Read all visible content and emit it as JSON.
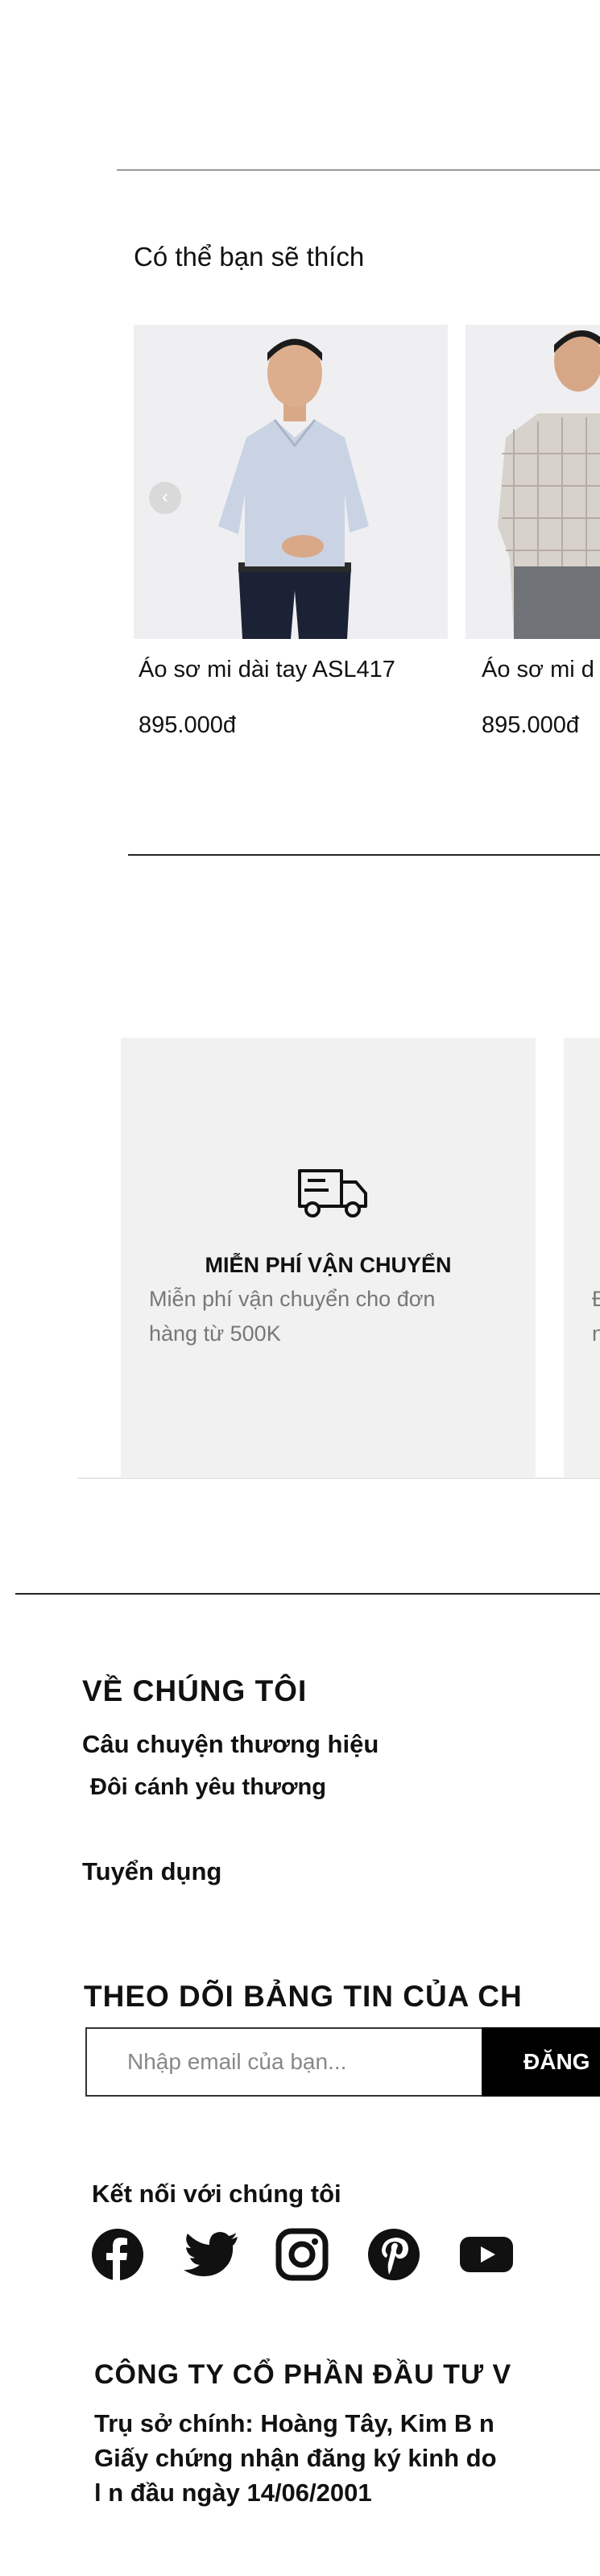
{
  "recommend": {
    "title": "Có thể bạn sẽ thích",
    "prev_arrow": "‹",
    "products": [
      {
        "name": "Áo sơ mi dài tay ASL417",
        "price": "895.000đ"
      },
      {
        "name": "Áo sơ mi d",
        "price": "895.000đ"
      }
    ]
  },
  "features": [
    {
      "icon": "truck-icon",
      "title": "MIỄN PHÍ VẬN CHUYỂN",
      "desc_line1": "Miễn phí vận chuyển cho đơn",
      "desc_line2": "hàng từ 500K"
    },
    {
      "icon": "",
      "title": "",
      "desc_line1": "Đ",
      "desc_line2": "n"
    }
  ],
  "footer": {
    "about_heading": "VỀ CHÚNG TÔI",
    "links": [
      "Câu chuyện thương hiệu",
      "Đôi cánh yêu thương",
      "Tuyển dụng"
    ],
    "newsletter_heading": "THEO DÕI BẢNG TIN CỦA CH",
    "email_placeholder": "Nhập email của bạn...",
    "subscribe_label": "ĐĂNG",
    "connect_label": "Kết nối với chúng tôi",
    "socials": [
      "facebook-icon",
      "twitter-icon",
      "instagram-icon",
      "pinterest-icon",
      "youtube-icon"
    ],
    "company_name": "CÔNG TY CỔ PHẦN ĐẦU TƯ  V",
    "company_lines": [
      "Trụ sở  chính: Hoàng Tây, Kim B n",
      "Giấy chứng nhận   đăng ký kinh do",
      "l n   đầu ngày 14/06/2001"
    ]
  }
}
